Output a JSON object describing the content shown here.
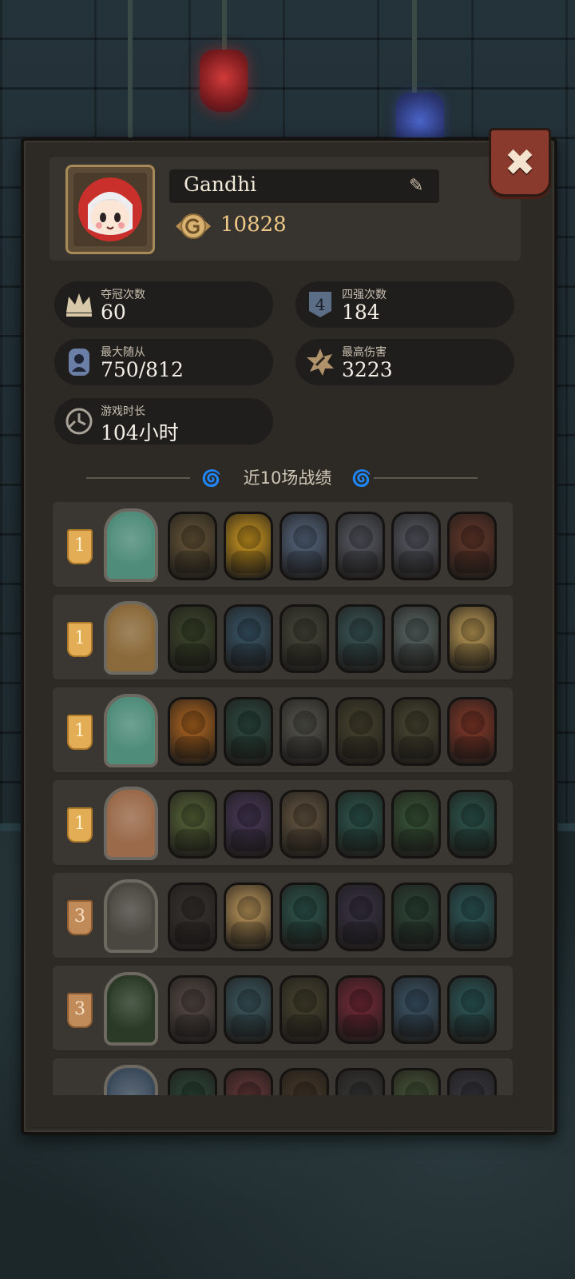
{
  "profile": {
    "name": "Gandhi",
    "coins": "10828"
  },
  "stats": [
    {
      "label": "夺冠次数",
      "value": "60",
      "icon": "crown-icon"
    },
    {
      "label": "四强次数",
      "value": "184",
      "icon": "top4-shield-icon"
    },
    {
      "label": "最大随从",
      "value": "750/812",
      "icon": "minion-card-icon"
    },
    {
      "label": "最高伤害",
      "value": "3223",
      "icon": "damage-burst-icon"
    },
    {
      "label": "游戏时长",
      "value": "104小时",
      "icon": "clock-icon"
    }
  ],
  "section_title": "近10场战绩",
  "matches": [
    {
      "rank": "1",
      "hero_color": "#4f8c7a",
      "units": [
        "#6b5a3a",
        "#d8a020",
        "#5a6c86",
        "#5c5f6a",
        "#5c5f6a",
        "#6a3a2c"
      ]
    },
    {
      "rank": "1",
      "hero_color": "#8a6a3a",
      "units": [
        "#3e4a2c",
        "#3b5a6e",
        "#4a4a3c",
        "#3c5a5c",
        "#5e6c6a",
        "#c8a45a"
      ]
    },
    {
      "rank": "1",
      "hero_color": "#4f8c7a",
      "units": [
        "#b86a20",
        "#2e4e44",
        "#5a5a52",
        "#4a4630",
        "#4c4a32",
        "#8a3a2a"
      ]
    },
    {
      "rank": "1",
      "hero_color": "#9a6a4a",
      "units": [
        "#5a6a3a",
        "#4a3a5c",
        "#6a5a44",
        "#2e5a50",
        "#3a5a3a",
        "#2e5a50"
      ]
    },
    {
      "rank": "3",
      "hero_color": "#4a4640",
      "units": [
        "#3a3430",
        "#c8a060",
        "#2e5a50",
        "#3a3448",
        "#2e4a3a",
        "#2e5e5e"
      ]
    },
    {
      "rank": "3",
      "hero_color": "#2a3a26",
      "units": [
        "#5a4e4a",
        "#3e5e66",
        "#4a4630",
        "#7a2a3a",
        "#3e5a6e",
        "#2e5e5e"
      ]
    },
    {
      "rank": "",
      "hero_color": "#3a4a5a",
      "units": [
        "#2e4a3a",
        "#6a3a3a",
        "#4a3a2a",
        "#3a3a3a",
        "#4a5a3a",
        "#3a3a44"
      ]
    }
  ]
}
